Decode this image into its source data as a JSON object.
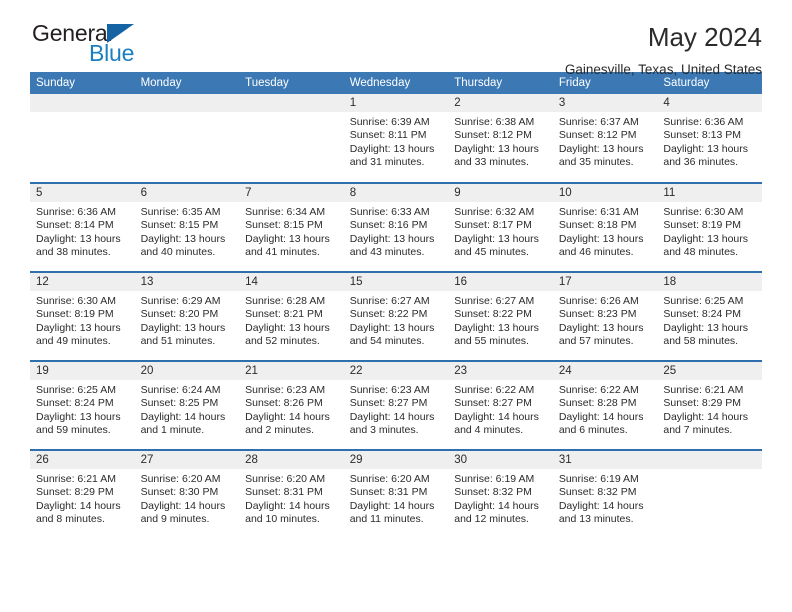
{
  "brand": {
    "name_top": "General",
    "name_bottom": "Blue",
    "triangle_color": "#1464a5",
    "blue_color": "#1a7fc1"
  },
  "header": {
    "title": "May 2024",
    "subtitle": "Gainesville, Texas, United States"
  },
  "theme": {
    "header_bg": "#3b78b4",
    "row_border": "#2f6fad",
    "daynum_bg": "#efefef",
    "text": "#2b2b2b"
  },
  "weekdays": [
    "Sunday",
    "Monday",
    "Tuesday",
    "Wednesday",
    "Thursday",
    "Friday",
    "Saturday"
  ],
  "weeks": [
    [
      {
        "day": "",
        "empty": true
      },
      {
        "day": "",
        "empty": true
      },
      {
        "day": "",
        "empty": true
      },
      {
        "day": "1",
        "sunrise": "Sunrise: 6:39 AM",
        "sunset": "Sunset: 8:11 PM",
        "daylight": "Daylight: 13 hours and 31 minutes."
      },
      {
        "day": "2",
        "sunrise": "Sunrise: 6:38 AM",
        "sunset": "Sunset: 8:12 PM",
        "daylight": "Daylight: 13 hours and 33 minutes."
      },
      {
        "day": "3",
        "sunrise": "Sunrise: 6:37 AM",
        "sunset": "Sunset: 8:12 PM",
        "daylight": "Daylight: 13 hours and 35 minutes."
      },
      {
        "day": "4",
        "sunrise": "Sunrise: 6:36 AM",
        "sunset": "Sunset: 8:13 PM",
        "daylight": "Daylight: 13 hours and 36 minutes."
      }
    ],
    [
      {
        "day": "5",
        "sunrise": "Sunrise: 6:36 AM",
        "sunset": "Sunset: 8:14 PM",
        "daylight": "Daylight: 13 hours and 38 minutes."
      },
      {
        "day": "6",
        "sunrise": "Sunrise: 6:35 AM",
        "sunset": "Sunset: 8:15 PM",
        "daylight": "Daylight: 13 hours and 40 minutes."
      },
      {
        "day": "7",
        "sunrise": "Sunrise: 6:34 AM",
        "sunset": "Sunset: 8:15 PM",
        "daylight": "Daylight: 13 hours and 41 minutes."
      },
      {
        "day": "8",
        "sunrise": "Sunrise: 6:33 AM",
        "sunset": "Sunset: 8:16 PM",
        "daylight": "Daylight: 13 hours and 43 minutes."
      },
      {
        "day": "9",
        "sunrise": "Sunrise: 6:32 AM",
        "sunset": "Sunset: 8:17 PM",
        "daylight": "Daylight: 13 hours and 45 minutes."
      },
      {
        "day": "10",
        "sunrise": "Sunrise: 6:31 AM",
        "sunset": "Sunset: 8:18 PM",
        "daylight": "Daylight: 13 hours and 46 minutes."
      },
      {
        "day": "11",
        "sunrise": "Sunrise: 6:30 AM",
        "sunset": "Sunset: 8:19 PM",
        "daylight": "Daylight: 13 hours and 48 minutes."
      }
    ],
    [
      {
        "day": "12",
        "sunrise": "Sunrise: 6:30 AM",
        "sunset": "Sunset: 8:19 PM",
        "daylight": "Daylight: 13 hours and 49 minutes."
      },
      {
        "day": "13",
        "sunrise": "Sunrise: 6:29 AM",
        "sunset": "Sunset: 8:20 PM",
        "daylight": "Daylight: 13 hours and 51 minutes."
      },
      {
        "day": "14",
        "sunrise": "Sunrise: 6:28 AM",
        "sunset": "Sunset: 8:21 PM",
        "daylight": "Daylight: 13 hours and 52 minutes."
      },
      {
        "day": "15",
        "sunrise": "Sunrise: 6:27 AM",
        "sunset": "Sunset: 8:22 PM",
        "daylight": "Daylight: 13 hours and 54 minutes."
      },
      {
        "day": "16",
        "sunrise": "Sunrise: 6:27 AM",
        "sunset": "Sunset: 8:22 PM",
        "daylight": "Daylight: 13 hours and 55 minutes."
      },
      {
        "day": "17",
        "sunrise": "Sunrise: 6:26 AM",
        "sunset": "Sunset: 8:23 PM",
        "daylight": "Daylight: 13 hours and 57 minutes."
      },
      {
        "day": "18",
        "sunrise": "Sunrise: 6:25 AM",
        "sunset": "Sunset: 8:24 PM",
        "daylight": "Daylight: 13 hours and 58 minutes."
      }
    ],
    [
      {
        "day": "19",
        "sunrise": "Sunrise: 6:25 AM",
        "sunset": "Sunset: 8:24 PM",
        "daylight": "Daylight: 13 hours and 59 minutes."
      },
      {
        "day": "20",
        "sunrise": "Sunrise: 6:24 AM",
        "sunset": "Sunset: 8:25 PM",
        "daylight": "Daylight: 14 hours and 1 minute."
      },
      {
        "day": "21",
        "sunrise": "Sunrise: 6:23 AM",
        "sunset": "Sunset: 8:26 PM",
        "daylight": "Daylight: 14 hours and 2 minutes."
      },
      {
        "day": "22",
        "sunrise": "Sunrise: 6:23 AM",
        "sunset": "Sunset: 8:27 PM",
        "daylight": "Daylight: 14 hours and 3 minutes."
      },
      {
        "day": "23",
        "sunrise": "Sunrise: 6:22 AM",
        "sunset": "Sunset: 8:27 PM",
        "daylight": "Daylight: 14 hours and 4 minutes."
      },
      {
        "day": "24",
        "sunrise": "Sunrise: 6:22 AM",
        "sunset": "Sunset: 8:28 PM",
        "daylight": "Daylight: 14 hours and 6 minutes."
      },
      {
        "day": "25",
        "sunrise": "Sunrise: 6:21 AM",
        "sunset": "Sunset: 8:29 PM",
        "daylight": "Daylight: 14 hours and 7 minutes."
      }
    ],
    [
      {
        "day": "26",
        "sunrise": "Sunrise: 6:21 AM",
        "sunset": "Sunset: 8:29 PM",
        "daylight": "Daylight: 14 hours and 8 minutes."
      },
      {
        "day": "27",
        "sunrise": "Sunrise: 6:20 AM",
        "sunset": "Sunset: 8:30 PM",
        "daylight": "Daylight: 14 hours and 9 minutes."
      },
      {
        "day": "28",
        "sunrise": "Sunrise: 6:20 AM",
        "sunset": "Sunset: 8:31 PM",
        "daylight": "Daylight: 14 hours and 10 minutes."
      },
      {
        "day": "29",
        "sunrise": "Sunrise: 6:20 AM",
        "sunset": "Sunset: 8:31 PM",
        "daylight": "Daylight: 14 hours and 11 minutes."
      },
      {
        "day": "30",
        "sunrise": "Sunrise: 6:19 AM",
        "sunset": "Sunset: 8:32 PM",
        "daylight": "Daylight: 14 hours and 12 minutes."
      },
      {
        "day": "31",
        "sunrise": "Sunrise: 6:19 AM",
        "sunset": "Sunset: 8:32 PM",
        "daylight": "Daylight: 14 hours and 13 minutes."
      },
      {
        "day": "",
        "empty": true
      }
    ]
  ]
}
